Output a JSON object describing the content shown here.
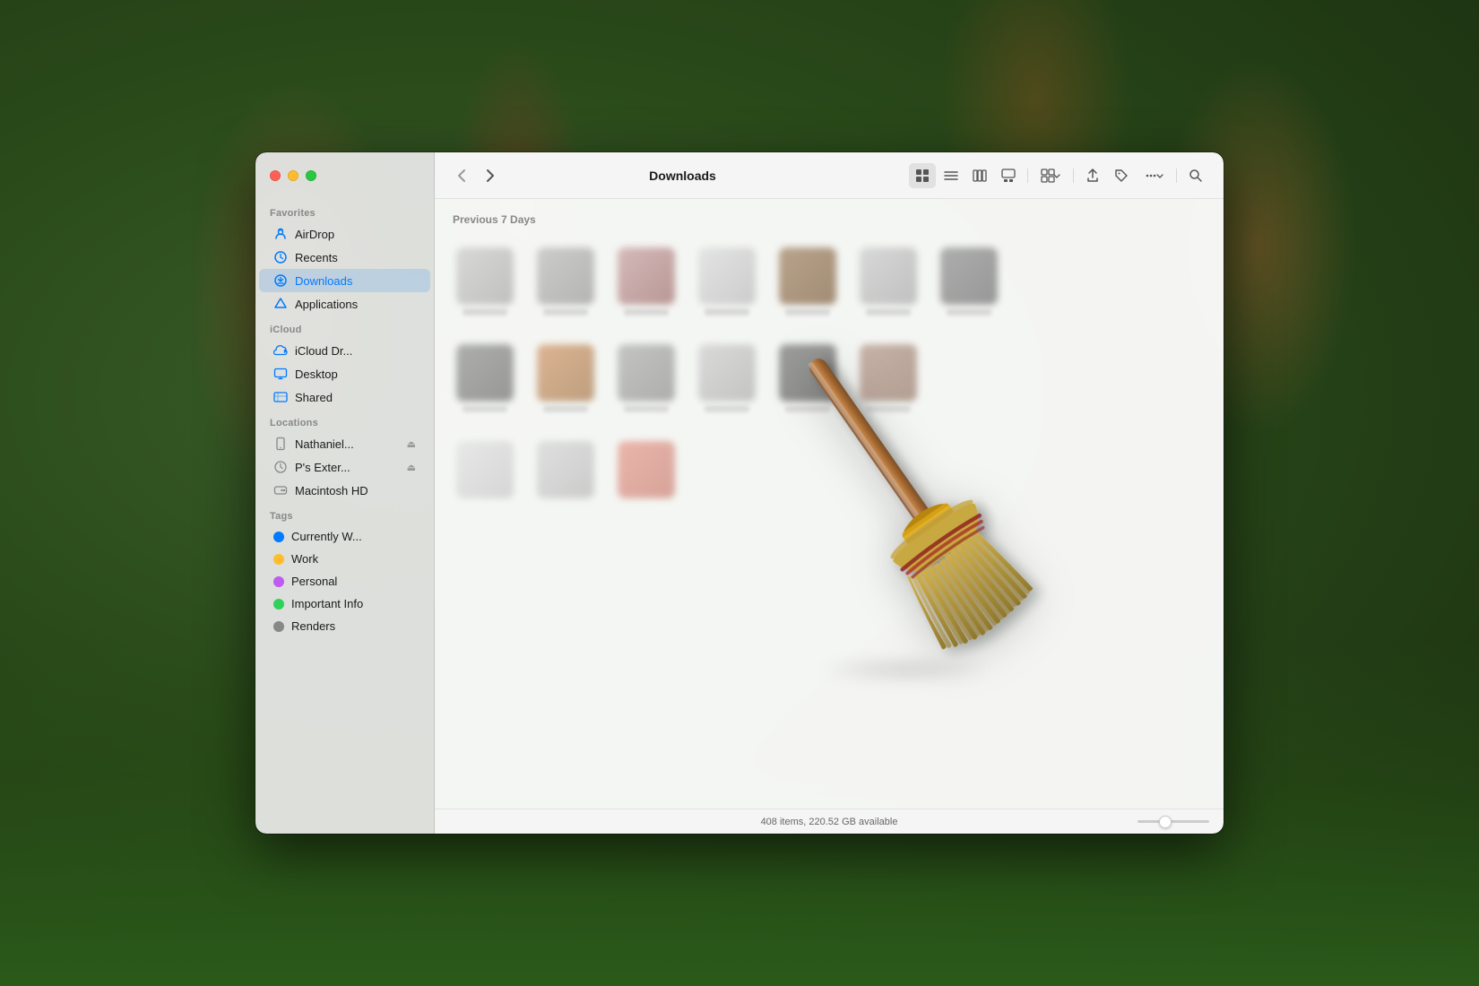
{
  "window": {
    "title": "Downloads"
  },
  "traffic_lights": {
    "close": "close",
    "minimize": "minimize",
    "maximize": "maximize"
  },
  "sidebar": {
    "sections": [
      {
        "label": "Favorites",
        "items": [
          {
            "id": "airdrop",
            "label": "AirDrop",
            "icon": "airdrop"
          },
          {
            "id": "recents",
            "label": "Recents",
            "icon": "recents"
          },
          {
            "id": "downloads",
            "label": "Downloads",
            "icon": "downloads",
            "active": true
          },
          {
            "id": "applications",
            "label": "Applications",
            "icon": "applications"
          }
        ]
      },
      {
        "label": "iCloud",
        "items": [
          {
            "id": "icloud-drive",
            "label": "iCloud Dr...",
            "icon": "icloud"
          },
          {
            "id": "desktop",
            "label": "Desktop",
            "icon": "desktop"
          },
          {
            "id": "shared",
            "label": "Shared",
            "icon": "shared"
          }
        ]
      },
      {
        "label": "Locations",
        "items": [
          {
            "id": "nathaniel",
            "label": "Nathaniel...",
            "icon": "device",
            "eject": true
          },
          {
            "id": "ps-external",
            "label": "P's Exter...",
            "icon": "clock-drive",
            "eject": true
          },
          {
            "id": "macintosh-hd",
            "label": "Macintosh HD",
            "icon": "harddrive"
          }
        ]
      },
      {
        "label": "Tags",
        "items": [
          {
            "id": "currently-working",
            "label": "Currently W...",
            "tag_color": "#007aff"
          },
          {
            "id": "work",
            "label": "Work",
            "tag_color": "#ffbd2e"
          },
          {
            "id": "personal",
            "label": "Personal",
            "tag_color": "#bf5af2"
          },
          {
            "id": "important-info",
            "label": "Important Info",
            "tag_color": "#30d158"
          },
          {
            "id": "renders",
            "label": "Renders",
            "tag_color": "#888"
          }
        ]
      }
    ]
  },
  "toolbar": {
    "back_label": "‹",
    "forward_label": "›",
    "title": "Downloads",
    "view_icons": [
      "grid",
      "list",
      "column",
      "gallery"
    ],
    "group_by_label": "⊞",
    "share_label": "share",
    "tag_label": "tag",
    "more_label": "•••",
    "search_label": "search"
  },
  "main": {
    "section_header": "Previous 7 Days",
    "status": "408 items, 220.52 GB available",
    "broom_present": true
  }
}
